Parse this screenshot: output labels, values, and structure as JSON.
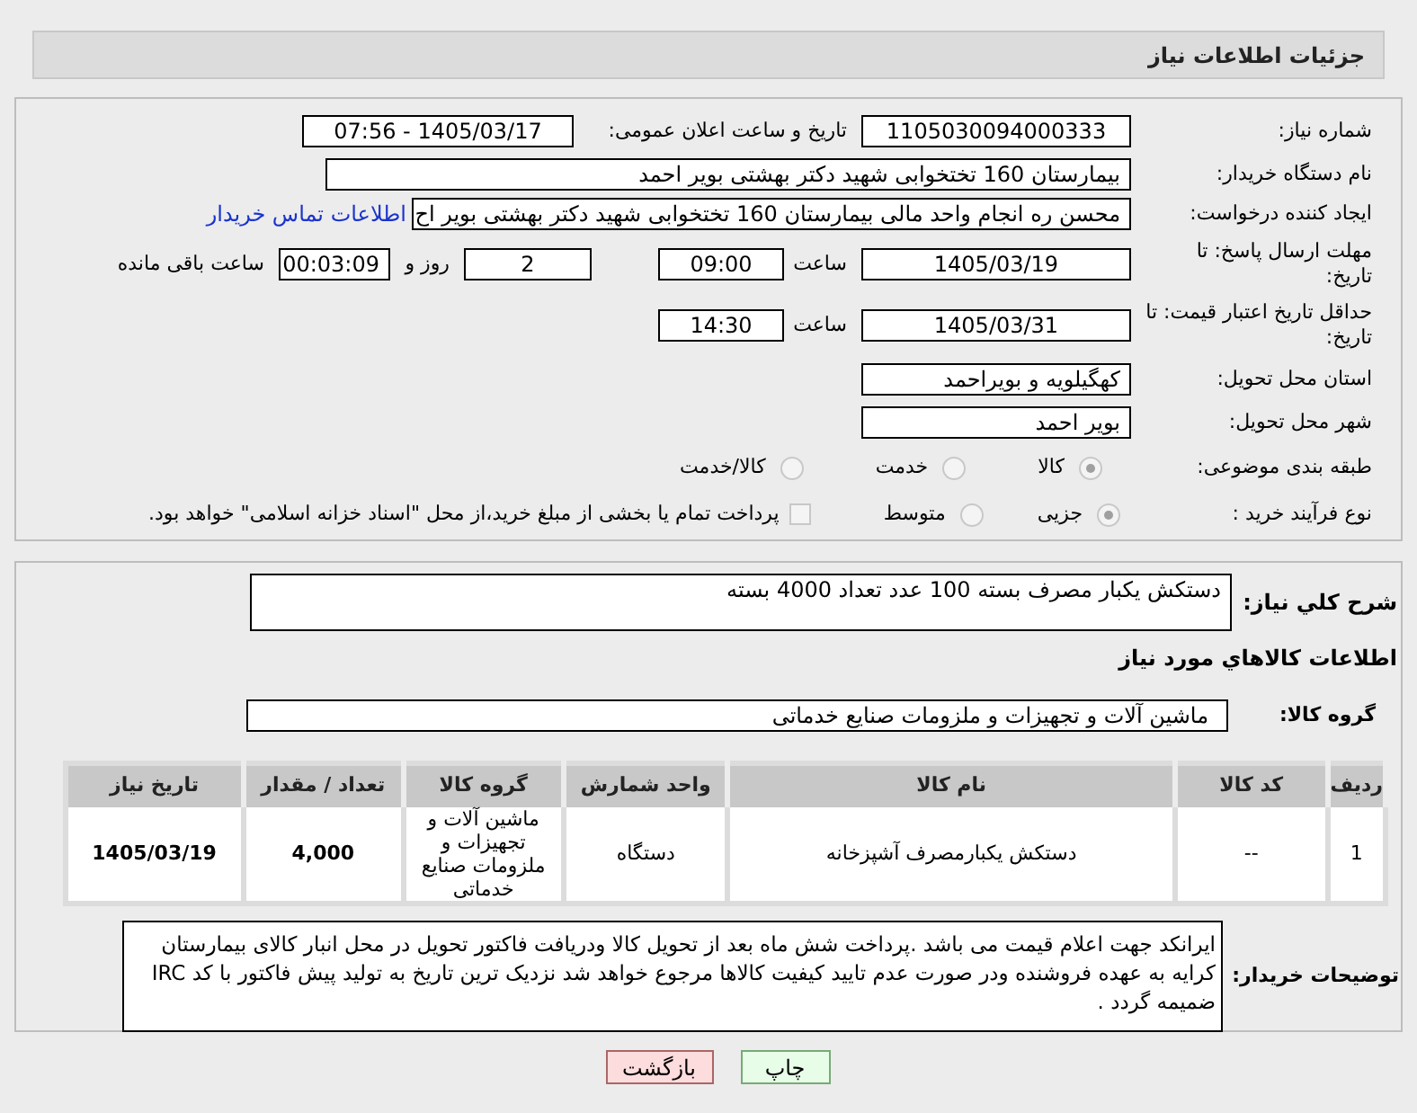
{
  "header": {
    "title": "جزئیات اطلاعات نیاز"
  },
  "need_number": {
    "label": "شماره نیاز:",
    "value": "1105030094000333"
  },
  "announce": {
    "label": "تاریخ و ساعت اعلان عمومی:",
    "value": "1405/03/17 - 07:56"
  },
  "buyer_org": {
    "label": "نام دستگاه خریدار:",
    "value": "بیمارستان 160 تختخوابی شهید دکتر بهشتی بویر احمد"
  },
  "requester": {
    "label": "ایجاد کننده درخواست:",
    "value": "محسن ره انجام واحد مالی بیمارستان 160 تختخوابی شهید دکتر بهشتی بویر اح",
    "link": "اطلاعات تماس خریدار"
  },
  "deadline": {
    "label": "مهلت ارسال پاسخ: تا تاریخ:",
    "date": "1405/03/19",
    "time_label": "ساعت",
    "time": "09:00",
    "days": "2",
    "days_label": "روز و",
    "remaining": "00:03:09",
    "remaining_label": "ساعت باقی مانده"
  },
  "validity": {
    "label": "حداقل تاریخ اعتبار قیمت: تا تاریخ:",
    "date": "1405/03/31",
    "time_label": "ساعت",
    "time": "14:30"
  },
  "province": {
    "label": "استان محل تحویل:",
    "value": "کهگیلویه و بویراحمد"
  },
  "city": {
    "label": "شهر محل تحویل:",
    "value": "بویر احمد"
  },
  "category": {
    "label": "طبقه بندی موضوعی:",
    "options": [
      {
        "label": "کالا",
        "selected": true
      },
      {
        "label": "خدمت",
        "selected": false
      },
      {
        "label": "کالا/خدمت",
        "selected": false
      }
    ]
  },
  "purchase_type": {
    "label": "نوع فرآیند خرید :",
    "options": [
      {
        "label": "جزیی",
        "selected": true
      },
      {
        "label": "متوسط",
        "selected": false
      }
    ],
    "treasury": {
      "checked": false,
      "text": "پرداخت تمام یا بخشی از مبلغ خرید،از محل \"اسناد خزانه اسلامی\" خواهد بود."
    }
  },
  "summary": {
    "label": "شرح کلي نياز:",
    "value": "دستکش یکبار مصرف بسته 100 عدد تعداد 4000 بسته"
  },
  "goods_heading": "اطلاعات كالاهاي مورد نياز",
  "goods_group": {
    "label": "گروه کالا:",
    "value": "ماشین آلات و تجهیزات و ملزومات صنایع خدماتی"
  },
  "table": {
    "columns": [
      "ردیف",
      "کد کالا",
      "نام کالا",
      "واحد شمارش",
      "گروه کالا",
      "تعداد / مقدار",
      "تاریخ نیاز"
    ],
    "rows": [
      [
        "1",
        "--",
        "دستکش یکبارمصرف آشپزخانه",
        "دستگاه",
        "ماشین آلات و تجهیزات و ملزومات صنایع خدماتی",
        "4,000",
        "1405/03/19"
      ]
    ]
  },
  "notes": {
    "label": "توضیحات خریدار:",
    "value": "ایرانکد جهت اعلام قیمت می باشد .پرداخت شش ماه بعد از تحویل کالا ودریافت فاکتور تحویل در محل انبار کالای بیمارستان کرایه به عهده فروشنده ودر صورت عدم تایید کیفیت کالاها مرجوع خواهد شد نزدیک ترین تاریخ به تولید پیش فاکتور با کد IRC ضمیمه گردد ."
  },
  "buttons": [
    {
      "kind": "print",
      "label": "چاپ"
    },
    {
      "kind": "back",
      "label": "بازگشت"
    }
  ]
}
